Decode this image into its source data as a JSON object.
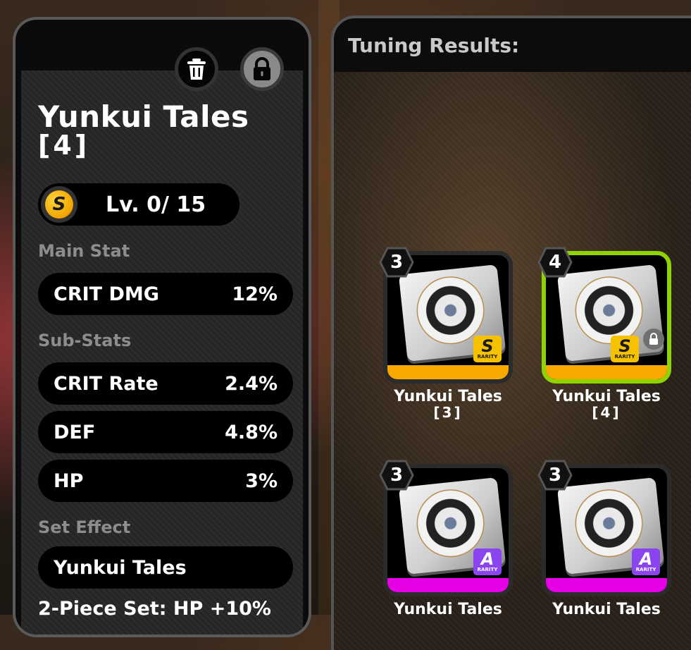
{
  "disc_detail": {
    "name": "Yunkui Tales",
    "tier": "[4]",
    "rank": "S",
    "level": "Lv. 0/ 15",
    "main_stat_label": "Main Stat",
    "main_stat": {
      "name": "CRIT DMG",
      "value": "12%"
    },
    "sub_stats_label": "Sub-Stats",
    "sub_stats": [
      {
        "name": "CRIT Rate",
        "value": "2.4%"
      },
      {
        "name": "DEF",
        "value": "4.8%"
      },
      {
        "name": "HP",
        "value": "3%"
      }
    ],
    "set_effect_label": "Set Effect",
    "set_name": "Yunkui Tales",
    "set_description": "2-Piece Set: HP +10%",
    "icons": {
      "delete": "trash-icon",
      "lock": "lock-icon"
    }
  },
  "tuning_results": {
    "title": "Tuning Results:",
    "cards": [
      {
        "name": "Yunkui Tales",
        "tier_label": "[3]",
        "badge": "3",
        "rarity": "S",
        "rarity_text": "RARITY",
        "selected": false,
        "locked": false
      },
      {
        "name": "Yunkui Tales",
        "tier_label": "[4]",
        "badge": "4",
        "rarity": "S",
        "rarity_text": "RARITY",
        "selected": true,
        "locked": true
      },
      {
        "name": "Yunkui Tales",
        "tier_label": "",
        "badge": "3",
        "rarity": "A",
        "rarity_text": "RARITY",
        "selected": false,
        "locked": false
      },
      {
        "name": "Yunkui Tales",
        "tier_label": "",
        "badge": "3",
        "rarity": "A",
        "rarity_text": "RARITY",
        "selected": false,
        "locked": false
      }
    ]
  },
  "colors": {
    "rarity_s": "#f8a800",
    "rarity_a": "#e600e6",
    "selected_border": "#8fd400"
  }
}
